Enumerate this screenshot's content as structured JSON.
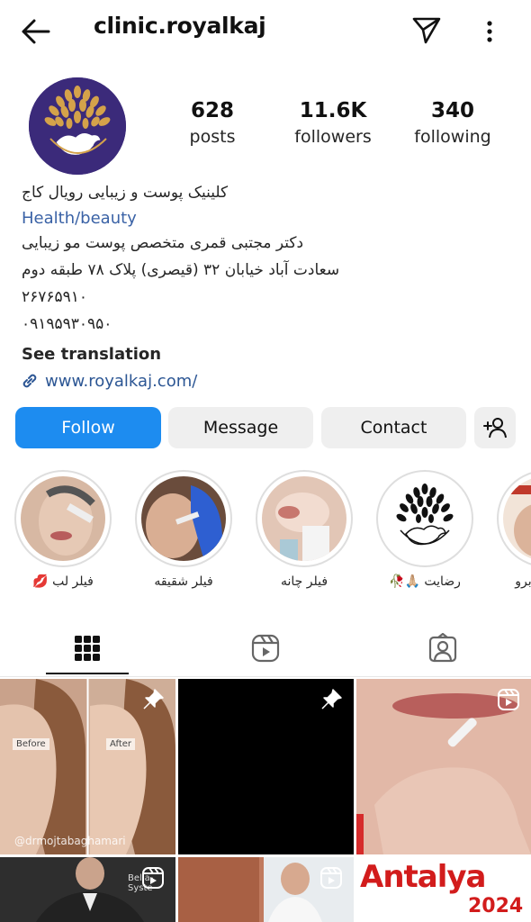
{
  "header": {
    "username": "clinic.royalkaj",
    "back_icon": "arrow-left-icon",
    "send_icon": "paper-plane-icon",
    "more_icon": "kebab-menu-icon"
  },
  "profile": {
    "avatar_icon": "peacock-logo",
    "stats": {
      "posts": {
        "value": "628",
        "label": "posts"
      },
      "followers": {
        "value": "11.6K",
        "label": "followers"
      },
      "following": {
        "value": "340",
        "label": "following"
      }
    },
    "name": "کلینیک پوست و زیبایی رویال کاج",
    "category": "Health/beauty",
    "bio_lines": [
      "دکتر مجتبی قمری متخصص پوست مو زیبایی",
      "سعادت آباد خیابان ۳۲ (قیصری) پلاک ۷۸ طبقه دوم",
      "۲۶۷۶۵۹۱۰",
      "۰۹۱۹۵۹۳۰۹۵۰"
    ],
    "see_translation": "See translation",
    "link": "www.royalkaj.com/"
  },
  "actions": {
    "follow": "Follow",
    "message": "Message",
    "contact": "Contact",
    "add_user_icon": "person-add-icon"
  },
  "highlights": [
    {
      "label": "فیلر لب 💋"
    },
    {
      "label": "فیلر شقیقه"
    },
    {
      "label": "فیلر چانه"
    },
    {
      "label": "رضایت 🙏🏼🥀"
    },
    {
      "label": "ج ابرو"
    }
  ],
  "tabs": [
    {
      "name": "grid",
      "icon": "grid-icon",
      "active": true
    },
    {
      "name": "reels",
      "icon": "reels-icon",
      "active": false
    },
    {
      "name": "tagged",
      "icon": "tagged-icon",
      "active": false
    }
  ],
  "posts": {
    "before_label": "Before",
    "after_label": "After",
    "watermark": "@drmojtabaghamari",
    "bella": "Bella-Syste",
    "antalya": "Antalya",
    "year": "2024"
  },
  "colors": {
    "accent": "#1d8cf0",
    "link": "#3a62a6",
    "button_bg": "#efefef",
    "avatar_bg": "#3b2a7a",
    "logo_gold": "#d4a24a"
  }
}
